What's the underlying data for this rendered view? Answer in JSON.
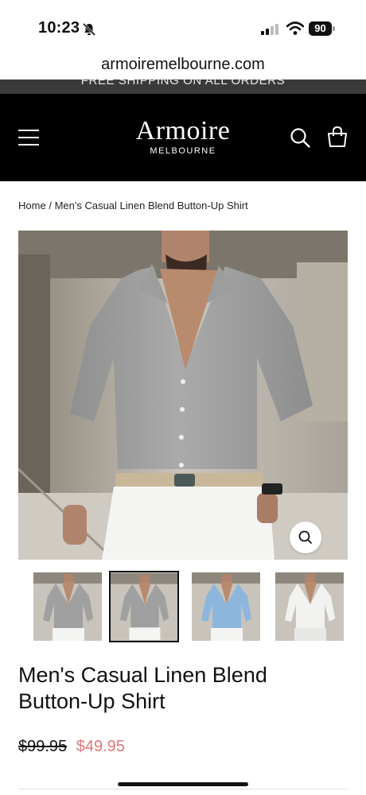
{
  "status": {
    "time": "10:23",
    "battery": "90"
  },
  "browser": {
    "url": "armoiremelbourne.com"
  },
  "announcement": "FREE SHIPPING ON ALL ORDERS",
  "header": {
    "logo_main": "Armoire",
    "logo_sub": "MELBOURNE"
  },
  "breadcrumb": {
    "home": "Home",
    "separator": "/",
    "current": "Men's Casual Linen Blend Button-Up Shirt"
  },
  "product": {
    "title": "Men's Casual Linen Blend Button-Up Shirt",
    "compare_price": "$99.95",
    "sale_price": "$49.95",
    "thumbnails": [
      {
        "color": "#9fa09f",
        "selected": false
      },
      {
        "color": "#9fa09f",
        "selected": true
      },
      {
        "color": "#8db6dc",
        "selected": false
      },
      {
        "color": "#f2f2f0",
        "selected": false
      }
    ]
  },
  "colors": {
    "header_bg": "#000000",
    "sale_price": "#e07777",
    "announcement_bg": "#3a3a3a"
  },
  "icons": [
    "bell-slash-icon",
    "signal-icon",
    "wifi-icon",
    "menu-icon",
    "search-icon",
    "cart-icon",
    "zoom-icon"
  ]
}
